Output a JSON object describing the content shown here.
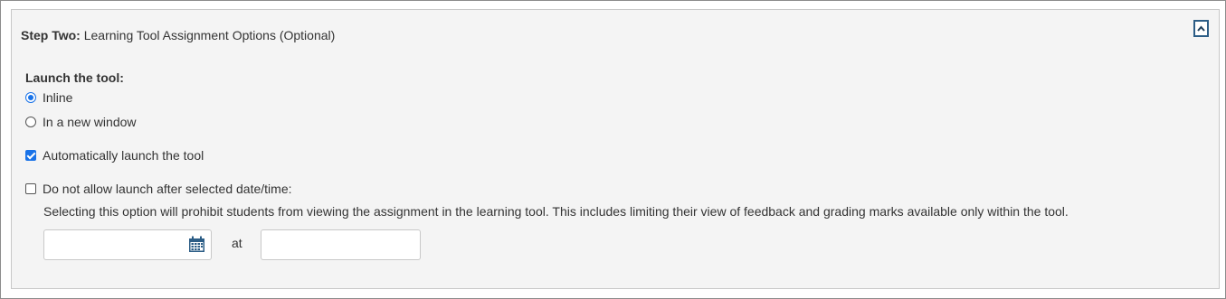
{
  "section": {
    "step_label": "Step Two:",
    "step_title": "Learning Tool Assignment Options (Optional)"
  },
  "launch": {
    "label": "Launch the tool:",
    "options": [
      {
        "label": "Inline",
        "selected": true
      },
      {
        "label": "In a new window",
        "selected": false
      }
    ]
  },
  "auto_launch": {
    "label": "Automatically launch the tool",
    "checked": true
  },
  "restrict": {
    "label": "Do not allow launch after selected date/time:",
    "checked": false,
    "description": "Selecting this option will prohibit students from viewing the assignment in the learning tool. This includes limiting their view of feedback and grading marks available only within the tool.",
    "date_value": "",
    "at_label": "at",
    "time_value": ""
  },
  "icons": {
    "collapse": "chevron-up-icon",
    "calendar": "calendar-icon"
  },
  "colors": {
    "accent": "#1a73e8",
    "button_border": "#2c5d86",
    "panel_bg": "#f4f4f4"
  }
}
